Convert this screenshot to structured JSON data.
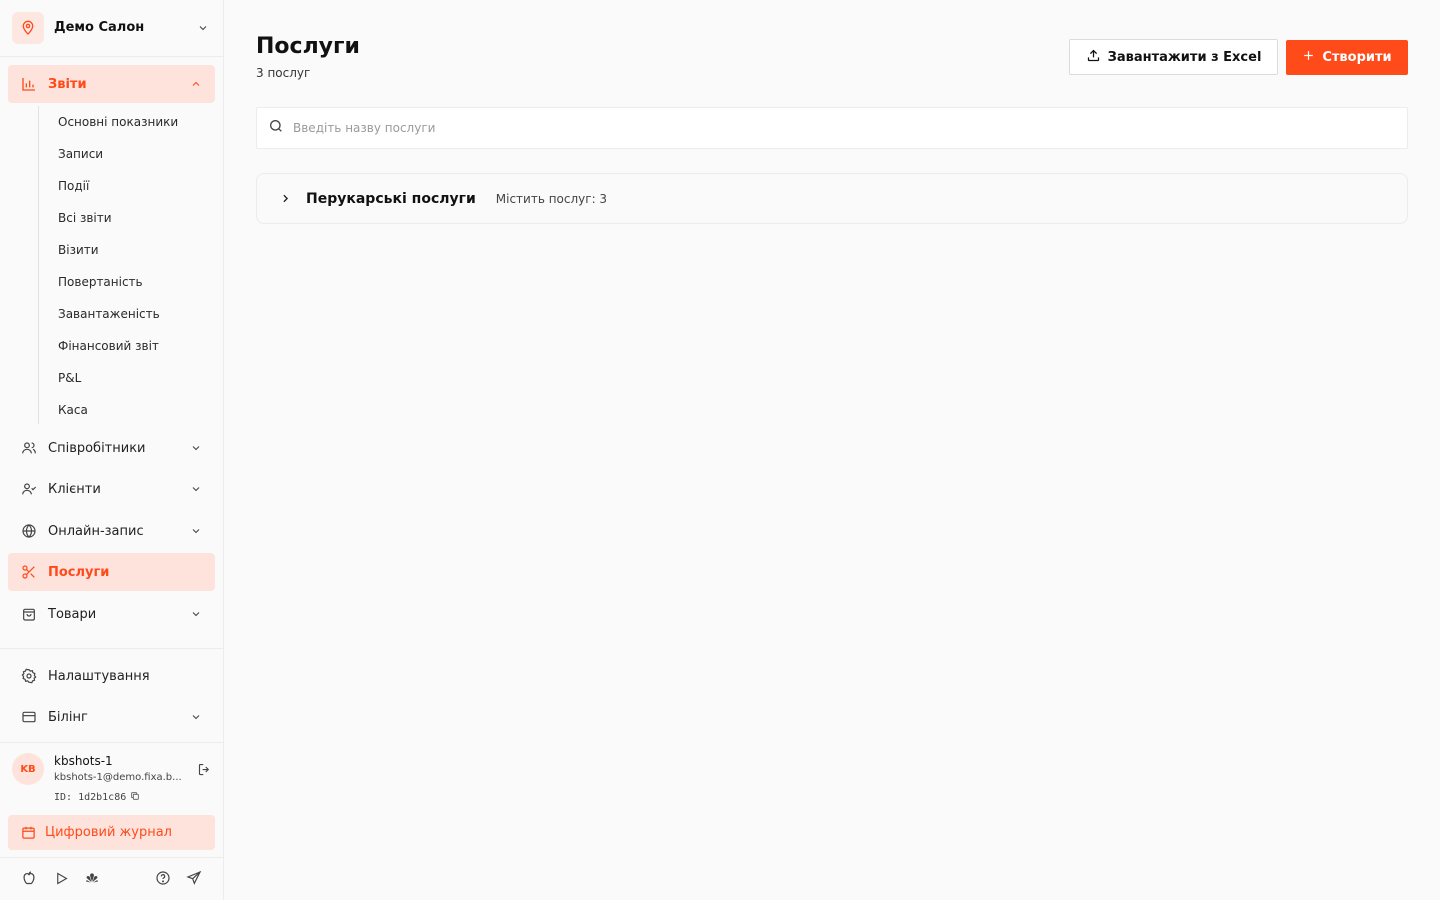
{
  "sidebar": {
    "salon_name": "Демо Салон",
    "nav": {
      "reports": "Звіти",
      "employees": "Співробітники",
      "clients": "Клієнти",
      "online": "Онлайн-запис",
      "services": "Послуги",
      "goods": "Товари",
      "settings": "Налаштування",
      "billing": "Білінг"
    },
    "reports_sub": [
      "Основні показники",
      "Записи",
      "Події",
      "Всі звіти",
      "Візити",
      "Повертаність",
      "Завантаженість",
      "Фінансовий звіт",
      "P&L",
      "Каса"
    ],
    "user": {
      "initials": "KB",
      "name": "kbshots-1",
      "email": "kbshots-1@demo.fixa.b...",
      "id": "ID: 1d2b1c86"
    },
    "journal": "Цифровий журнал",
    "bottom_icons": [
      "apple-icon",
      "play-icon",
      "huawei-icon",
      "help-icon",
      "telegram-icon"
    ]
  },
  "main": {
    "title": "Послуги",
    "subtitle": "3 послуг",
    "excel_button": "Завантажити з Excel",
    "create_button": "Створити",
    "search_placeholder": "Введіть назву послуги",
    "categories": [
      {
        "name": "Перукарські послуги",
        "count": "Містить послуг: 3"
      }
    ]
  },
  "colors": {
    "accent": "#ff4a1a",
    "accent_bg": "#fde3dc",
    "page_bg": "#fafafa"
  }
}
